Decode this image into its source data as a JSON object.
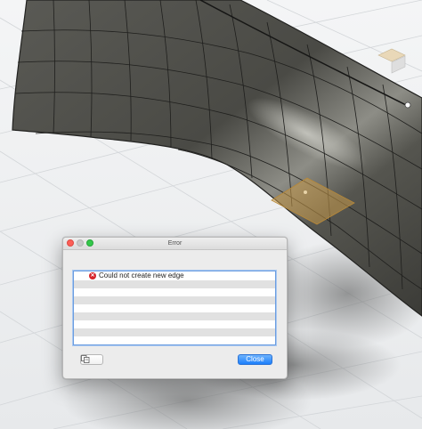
{
  "app": {
    "canvas_background": "#eef0f2",
    "model_color": "#4c4c46",
    "highlight_color": "#c89a4a"
  },
  "dialog": {
    "title": "Error",
    "window_buttons": [
      "close",
      "minimize",
      "zoom"
    ],
    "messages": [
      {
        "icon": "error-icon",
        "text": "Could not create new edge"
      }
    ],
    "copy_button_icon": "copy-icon",
    "close_label": "Close",
    "accent_color": "#1c7ffb",
    "error_color": "#d6232a"
  }
}
